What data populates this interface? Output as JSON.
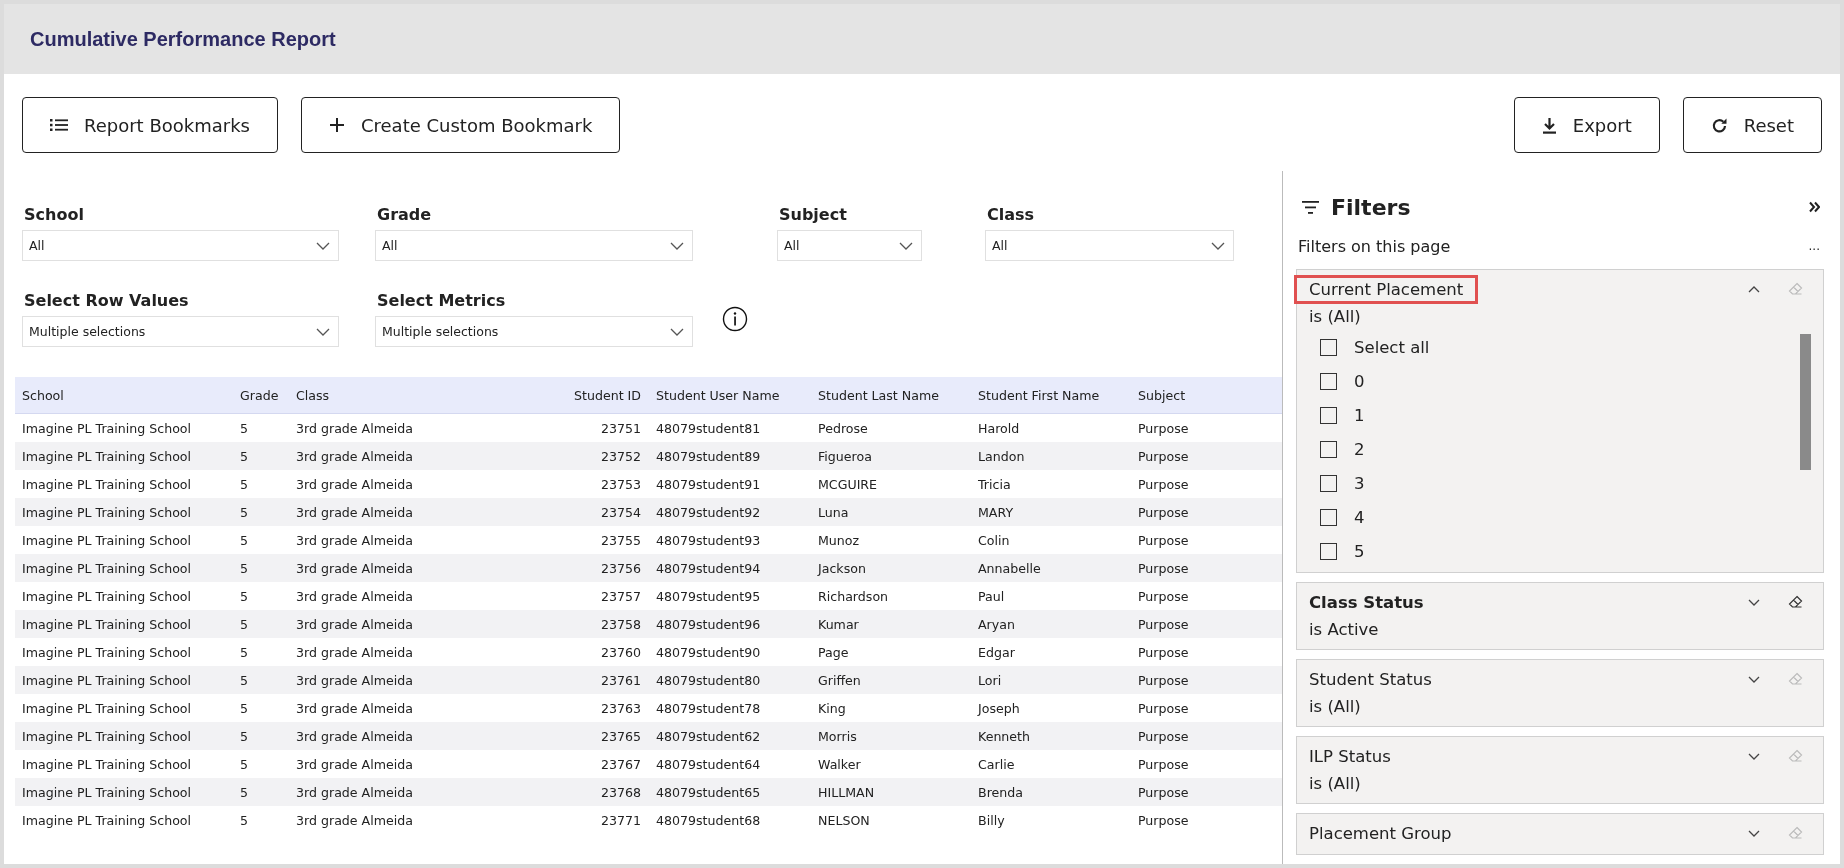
{
  "title": "Cumulative Performance Report",
  "toolbar": {
    "left": [
      {
        "label": "Report Bookmarks"
      },
      {
        "label": "Create Custom Bookmark"
      }
    ],
    "right": [
      {
        "label": "Export"
      },
      {
        "label": "Reset"
      }
    ]
  },
  "slicers": [
    [
      {
        "label": "School",
        "value": "All"
      },
      {
        "label": "Grade",
        "value": "All"
      },
      {
        "label": "Subject",
        "value": "All"
      },
      {
        "label": "Class",
        "value": "All"
      }
    ],
    [
      {
        "label": "Select Row Values",
        "value": "Multiple selections"
      },
      {
        "label": "Select Metrics",
        "value": "Multiple selections"
      }
    ]
  ],
  "table": {
    "columns": [
      "School",
      "Grade",
      "Class",
      "Student ID",
      "Student User Name",
      "Student Last Name",
      "Student First Name",
      "Subject"
    ],
    "rows": [
      [
        "Imagine PL Training School",
        "5",
        "3rd grade Almeida",
        "23751",
        "48079student81",
        "Pedrose",
        "Harold",
        "Purpose"
      ],
      [
        "Imagine PL Training School",
        "5",
        "3rd grade Almeida",
        "23752",
        "48079student89",
        "Figueroa",
        "Landon",
        "Purpose"
      ],
      [
        "Imagine PL Training School",
        "5",
        "3rd grade Almeida",
        "23753",
        "48079student91",
        "MCGUIRE",
        "Tricia",
        "Purpose"
      ],
      [
        "Imagine PL Training School",
        "5",
        "3rd grade Almeida",
        "23754",
        "48079student92",
        "Luna",
        "MARY",
        "Purpose"
      ],
      [
        "Imagine PL Training School",
        "5",
        "3rd grade Almeida",
        "23755",
        "48079student93",
        "Munoz",
        "Colin",
        "Purpose"
      ],
      [
        "Imagine PL Training School",
        "5",
        "3rd grade Almeida",
        "23756",
        "48079student94",
        "Jackson",
        "Annabelle",
        "Purpose"
      ],
      [
        "Imagine PL Training School",
        "5",
        "3rd grade Almeida",
        "23757",
        "48079student95",
        "Richardson",
        "Paul",
        "Purpose"
      ],
      [
        "Imagine PL Training School",
        "5",
        "3rd grade Almeida",
        "23758",
        "48079student96",
        "Kumar",
        "Aryan",
        "Purpose"
      ],
      [
        "Imagine PL Training School",
        "5",
        "3rd grade Almeida",
        "23760",
        "48079student90",
        "Page",
        "Edgar",
        "Purpose"
      ],
      [
        "Imagine PL Training School",
        "5",
        "3rd grade Almeida",
        "23761",
        "48079student80",
        "Griffen",
        "Lori",
        "Purpose"
      ],
      [
        "Imagine PL Training School",
        "5",
        "3rd grade Almeida",
        "23763",
        "48079student78",
        "King",
        "Joseph",
        "Purpose"
      ],
      [
        "Imagine PL Training School",
        "5",
        "3rd grade Almeida",
        "23765",
        "48079student62",
        "Morris",
        "Kenneth",
        "Purpose"
      ],
      [
        "Imagine PL Training School",
        "5",
        "3rd grade Almeida",
        "23767",
        "48079student64",
        "Walker",
        "Carlie",
        "Purpose"
      ],
      [
        "Imagine PL Training School",
        "5",
        "3rd grade Almeida",
        "23768",
        "48079student65",
        "HILLMAN",
        "Brenda",
        "Purpose"
      ],
      [
        "Imagine PL Training School",
        "5",
        "3rd grade Almeida",
        "23771",
        "48079student68",
        "NELSON",
        "Billy",
        "Purpose"
      ]
    ]
  },
  "filter_pane": {
    "title": "Filters",
    "section": "Filters on this page",
    "more": "...",
    "cards": [
      {
        "title": "Current Placement",
        "summary": "is (All)",
        "expanded": true,
        "applied": false,
        "highlighted": true,
        "options": [
          {
            "label": "Select all",
            "checked": false
          },
          {
            "label": "0",
            "checked": false
          },
          {
            "label": "1",
            "checked": false
          },
          {
            "label": "2",
            "checked": false
          },
          {
            "label": "3",
            "checked": false
          },
          {
            "label": "4",
            "checked": false
          },
          {
            "label": "5",
            "checked": false
          }
        ]
      },
      {
        "title": "Class Status",
        "summary": "is Active",
        "expanded": false,
        "applied": true,
        "highlighted": false
      },
      {
        "title": "Student Status",
        "summary": "is (All)",
        "expanded": false,
        "applied": false,
        "highlighted": false
      },
      {
        "title": "ILP Status",
        "summary": "is (All)",
        "expanded": false,
        "applied": false,
        "highlighted": false
      },
      {
        "title": "Placement Group",
        "expanded": false,
        "applied": false,
        "highlighted": false
      }
    ]
  }
}
